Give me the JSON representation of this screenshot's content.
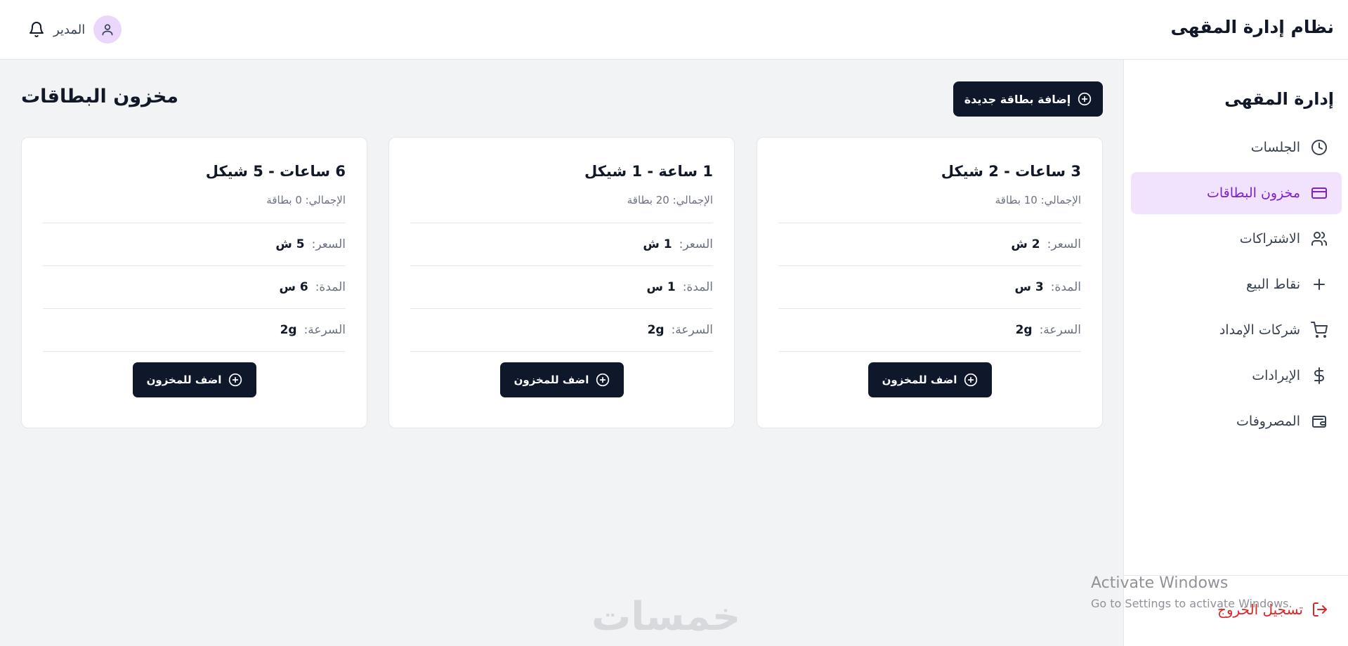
{
  "header": {
    "app_title": "نظام إدارة المقهى",
    "user_name": "المدير"
  },
  "sidebar": {
    "title": "إدارة المقهى",
    "items": [
      {
        "label": "الجلسات",
        "icon": "clock-icon",
        "active": false
      },
      {
        "label": "مخزون البطاقات",
        "icon": "credit-card-icon",
        "active": true
      },
      {
        "label": "الاشتراكات",
        "icon": "users-icon",
        "active": false
      },
      {
        "label": "نقاط البيع",
        "icon": "plus-icon",
        "active": false
      },
      {
        "label": "شركات الإمداد",
        "icon": "cart-icon",
        "active": false
      },
      {
        "label": "الإيرادات",
        "icon": "dollar-icon",
        "active": false
      },
      {
        "label": "المصروفات",
        "icon": "wallet-icon",
        "active": false
      }
    ],
    "logout_label": "تسجيل الخروج"
  },
  "main": {
    "page_title": "مخزون البطاقات",
    "add_card_label": "إضافة بطاقة جديدة",
    "cards": [
      {
        "title": "3 ساعات - 2 شيكل",
        "total": "الإجمالي: 10 بطاقة",
        "price_label": "السعر:",
        "price_value": "2 ش",
        "duration_label": "المدة:",
        "duration_value": "3 س",
        "speed_label": "السرعة:",
        "speed_value": "2g",
        "button_label": "اضف للمخزون"
      },
      {
        "title": "1 ساعة - 1 شيكل",
        "total": "الإجمالي: 20 بطاقة",
        "price_label": "السعر:",
        "price_value": "1 ش",
        "duration_label": "المدة:",
        "duration_value": "1 س",
        "speed_label": "السرعة:",
        "speed_value": "2g",
        "button_label": "اضف للمخزون"
      },
      {
        "title": "6 ساعات - 5 شيكل",
        "total": "الإجمالي: 0 بطاقة",
        "price_label": "السعر:",
        "price_value": "5 ش",
        "duration_label": "المدة:",
        "duration_value": "6 س",
        "speed_label": "السرعة:",
        "speed_value": "2g",
        "button_label": "اضف للمخزون"
      }
    ]
  },
  "overlay": {
    "activate_title": "Activate Windows",
    "activate_sub": "Go to Settings to activate Windows.",
    "site_watermark": "خمسات"
  },
  "colors": {
    "accent": "#7e22ce",
    "active_bg": "#f1e3fd",
    "button_bg": "#0f172a",
    "logout": "#dc2626",
    "avatar_bg": "#ead7fb"
  }
}
